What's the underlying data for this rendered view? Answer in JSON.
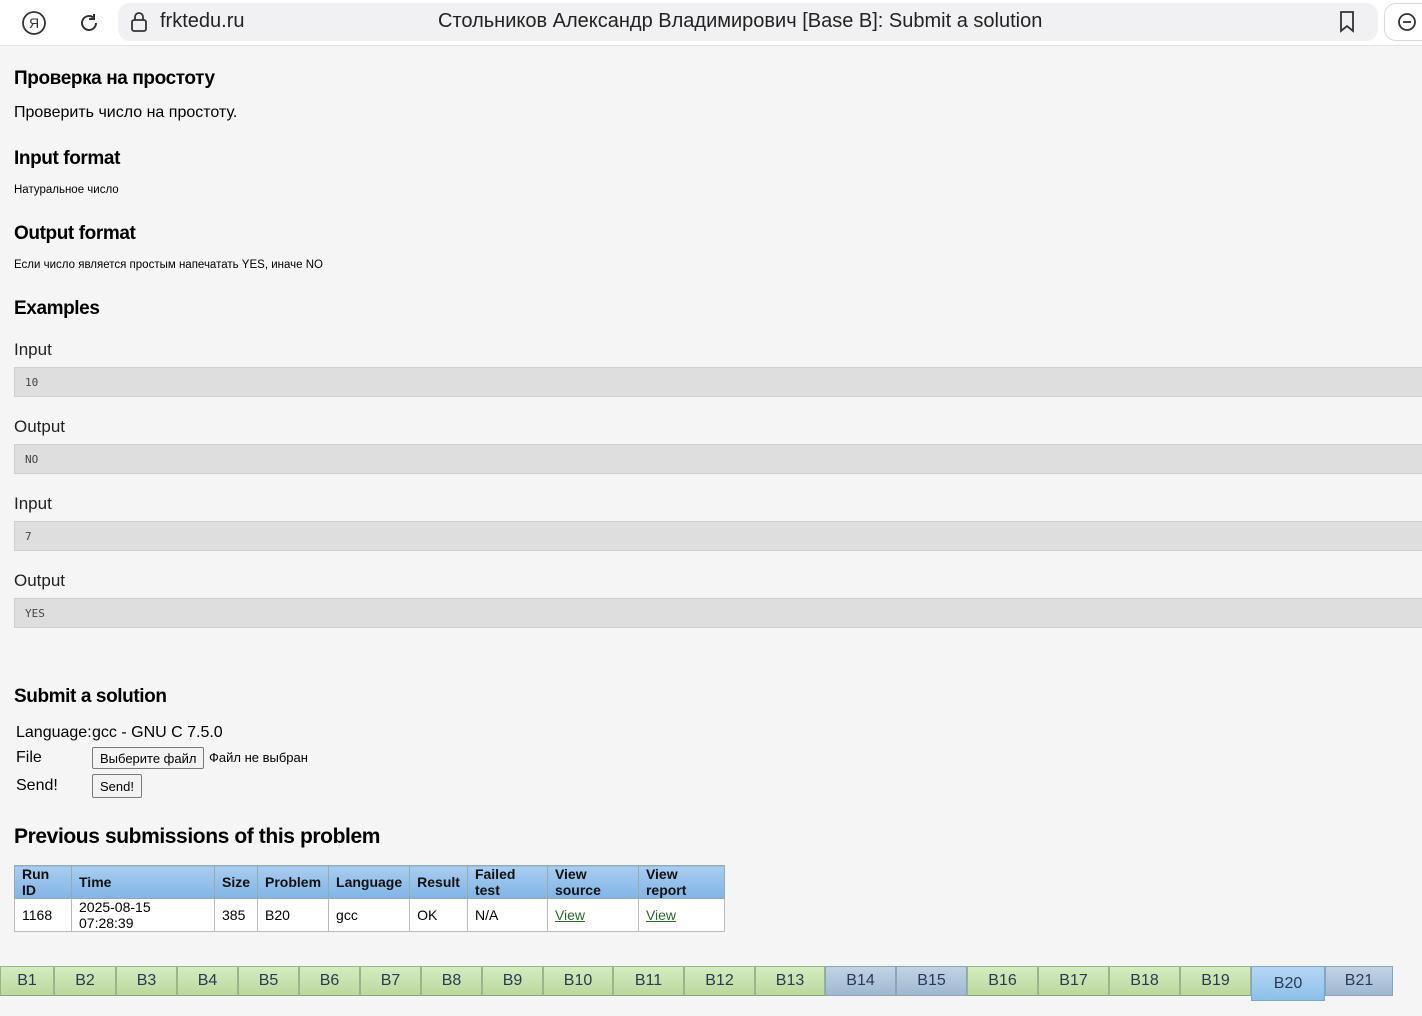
{
  "browser": {
    "domain": "frktedu.ru",
    "title": "Стольников Александр Владимирович [Base B]: Submit a solution"
  },
  "problem": {
    "title": "Проверка на простоту",
    "statement": "Проверить число на простоту.",
    "input_heading": "Input format",
    "input_text": "Натуральное число",
    "output_heading": "Output format",
    "output_text": "Если число является простым напечатать YES, иначе NO",
    "examples_heading": "Examples",
    "examples": [
      {
        "input_label": "Input",
        "input": "10",
        "output_label": "Output",
        "output": "NO"
      },
      {
        "input_label": "Input",
        "input": "7",
        "output_label": "Output",
        "output": "YES"
      }
    ]
  },
  "submit": {
    "heading": "Submit a solution",
    "language_label": "Language:",
    "language_value": "gcc - GNU C 7.5.0",
    "file_label": "File",
    "file_button": "Выберите файл",
    "file_status": "Файл не выбран",
    "send_label": "Send!",
    "send_button": "Send!"
  },
  "submissions": {
    "heading": "Previous submissions of this problem",
    "columns": [
      "Run ID",
      "Time",
      "Size",
      "Problem",
      "Language",
      "Result",
      "Failed test",
      "View source",
      "View report"
    ],
    "rows": [
      [
        "1168",
        "2025-08-15 07:28:39",
        "385",
        "B20",
        "gcc",
        "OK",
        "N/A",
        "View",
        "View"
      ]
    ]
  },
  "tabs": [
    {
      "label": "B1",
      "state": "green"
    },
    {
      "label": "B2",
      "state": "green"
    },
    {
      "label": "B3",
      "state": "green"
    },
    {
      "label": "B4",
      "state": "green"
    },
    {
      "label": "B5",
      "state": "green"
    },
    {
      "label": "B6",
      "state": "green"
    },
    {
      "label": "B7",
      "state": "green"
    },
    {
      "label": "B8",
      "state": "green"
    },
    {
      "label": "B9",
      "state": "green"
    },
    {
      "label": "B10",
      "state": "green"
    },
    {
      "label": "B11",
      "state": "green"
    },
    {
      "label": "B12",
      "state": "green"
    },
    {
      "label": "B13",
      "state": "green"
    },
    {
      "label": "B14",
      "state": "blue"
    },
    {
      "label": "B15",
      "state": "blue"
    },
    {
      "label": "B16",
      "state": "green"
    },
    {
      "label": "B17",
      "state": "green"
    },
    {
      "label": "B18",
      "state": "green"
    },
    {
      "label": "B19",
      "state": "green"
    },
    {
      "label": "B20",
      "state": "active"
    },
    {
      "label": "B21",
      "state": "blue"
    }
  ]
}
